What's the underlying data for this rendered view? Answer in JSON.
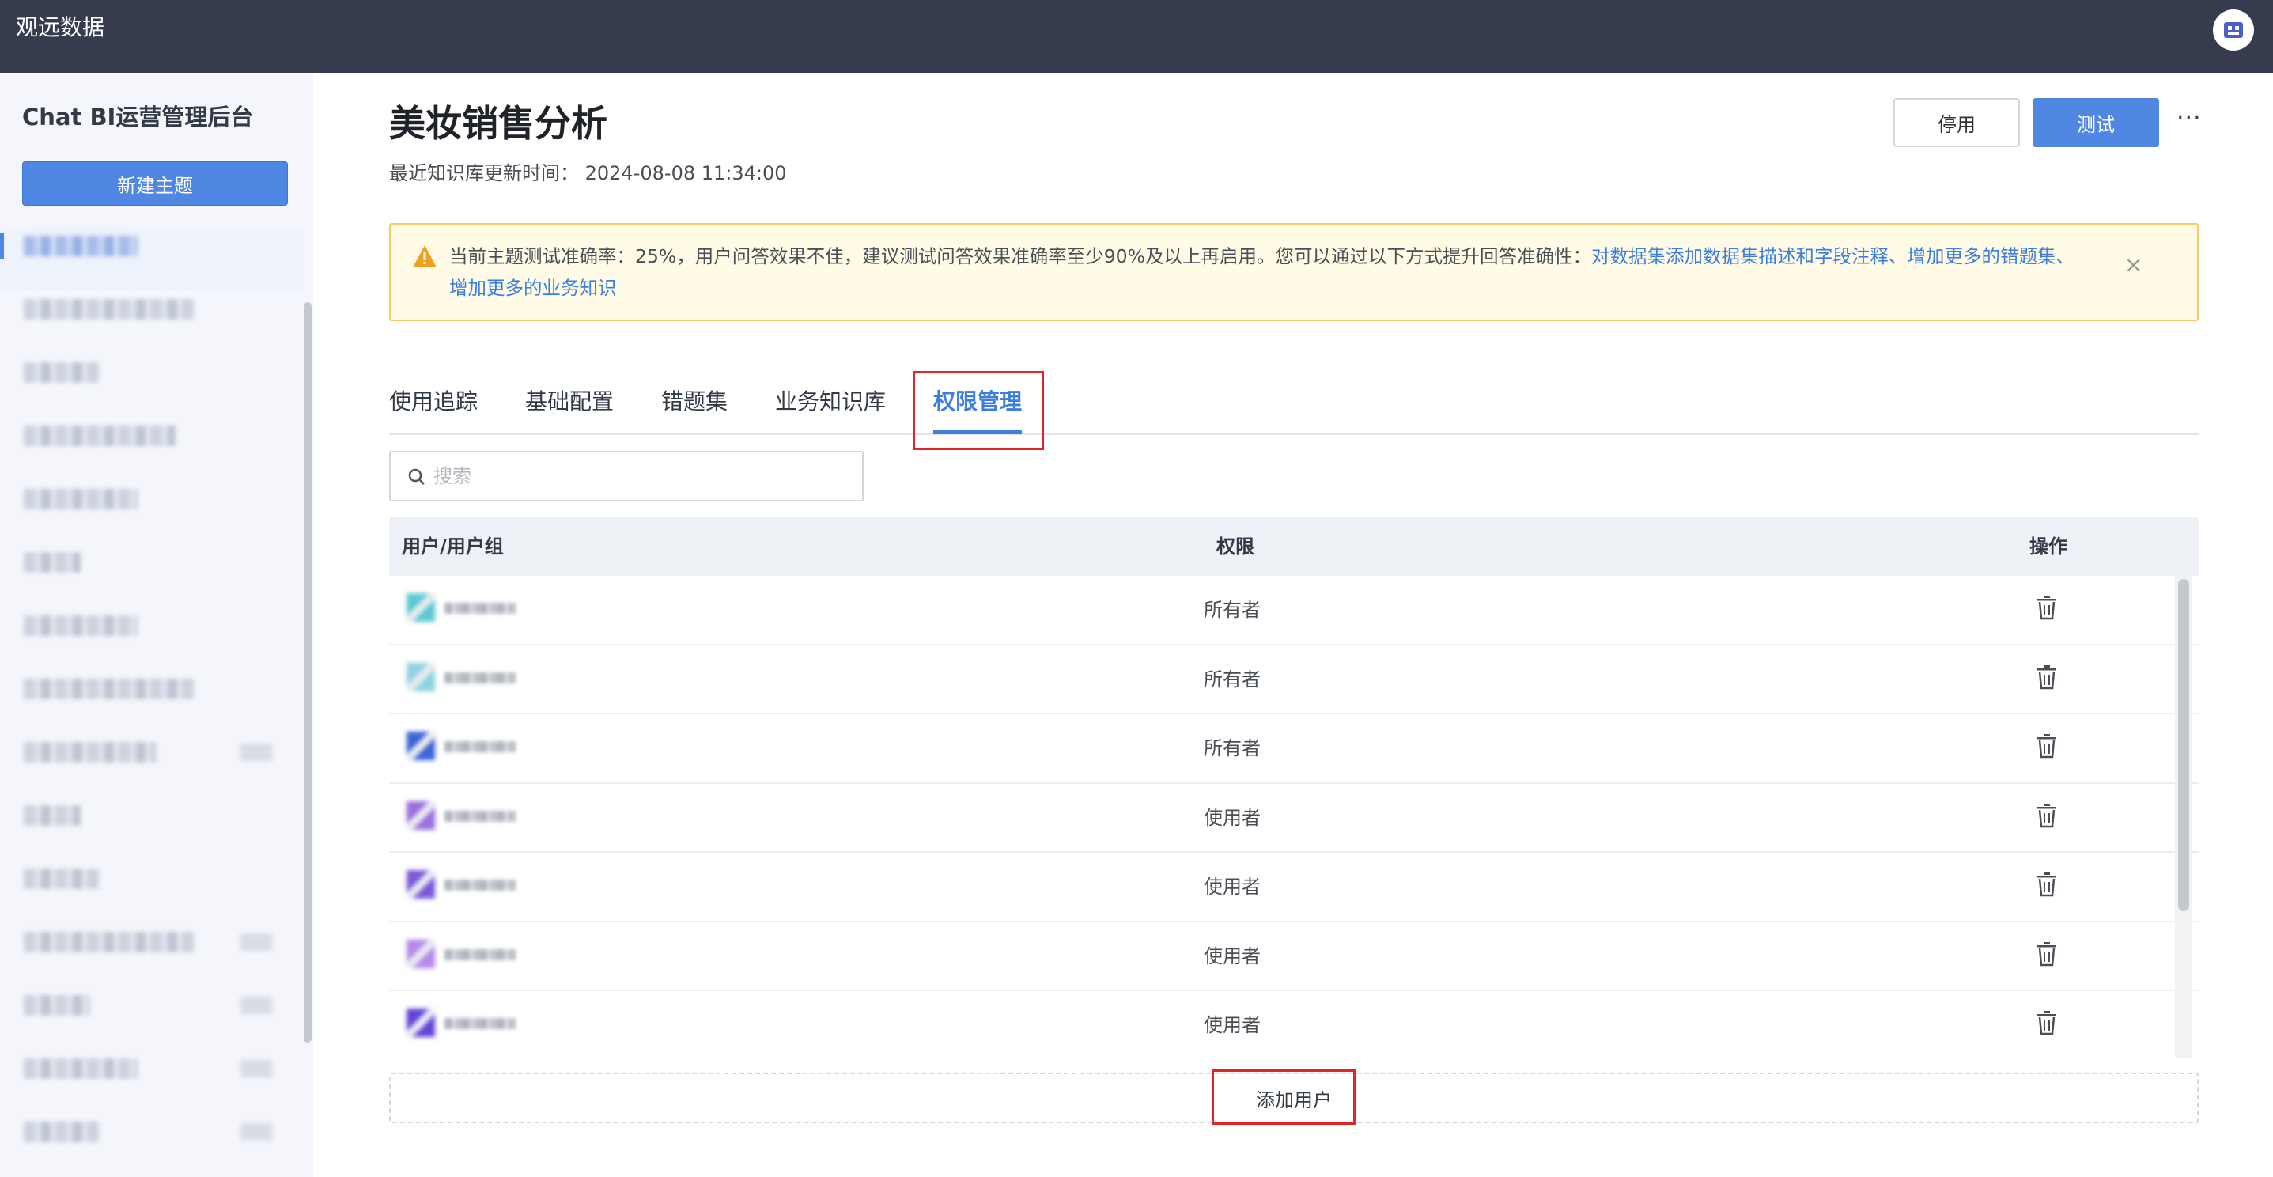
{
  "topbar": {
    "brand": "观远数据",
    "logo_icon": "brand-logo-icon"
  },
  "sidebar": {
    "title": "Chat BI运营管理后台",
    "new_topic_label": "新建主题",
    "items": [
      {
        "blur_width": 144,
        "tag": false,
        "active": true
      },
      {
        "blur_width": 216,
        "tag": false
      },
      {
        "blur_width": 96,
        "tag": false
      },
      {
        "blur_width": 192,
        "tag": false
      },
      {
        "blur_width": 144,
        "tag": false
      },
      {
        "blur_width": 72,
        "tag": false
      },
      {
        "blur_width": 144,
        "tag": false
      },
      {
        "blur_width": 216,
        "tag": false
      },
      {
        "blur_width": 168,
        "tag": true
      },
      {
        "blur_width": 72,
        "tag": false
      },
      {
        "blur_width": 96,
        "tag": false
      },
      {
        "blur_width": 216,
        "tag": true
      },
      {
        "blur_width": 84,
        "tag": true
      },
      {
        "blur_width": 144,
        "tag": true
      },
      {
        "blur_width": 96,
        "tag": true
      }
    ]
  },
  "header": {
    "title": "美妆销售分析",
    "update_time": "最近知识库更新时间： 2024-08-08 11:34:00",
    "stop_label": "停用",
    "test_label": "测试",
    "more_label": "···"
  },
  "alert": {
    "text": "当前主题测试准确率：25%，用户问答效果不佳，建议测试问答效果准确率至少90%及以上再启用。您可以通过以下方式提升回答准确性：",
    "link1": "对数据集添加数据集描述和字段注释、增加更多的错题集、",
    "link2": "增加更多的业务知识",
    "close_label": "×"
  },
  "tabs": [
    {
      "label": "使用追踪",
      "active": false
    },
    {
      "label": "基础配置",
      "active": false
    },
    {
      "label": "错题集",
      "active": false
    },
    {
      "label": "业务知识库",
      "active": false
    },
    {
      "label": "权限管理",
      "active": true
    }
  ],
  "search": {
    "placeholder": "搜索",
    "value": ""
  },
  "table": {
    "headers": [
      "用户/用户组",
      "权限",
      "操作"
    ],
    "rows": [
      {
        "permission": "所有者",
        "avatar_color": "#5cc8d4"
      },
      {
        "permission": "所有者",
        "avatar_color": "#8fd3df"
      },
      {
        "permission": "所有者",
        "avatar_color": "#3f63d6"
      },
      {
        "permission": "使用者",
        "avatar_color": "#9a6fe0"
      },
      {
        "permission": "使用者",
        "avatar_color": "#7a5ad8"
      },
      {
        "permission": "使用者",
        "avatar_color": "#b48ae8"
      },
      {
        "permission": "使用者",
        "avatar_color": "#6444d8"
      }
    ]
  },
  "add_user_label": "添加用户",
  "colors": {
    "accent": "#4f87e3",
    "topbar": "#363c4d",
    "highlight": "#e0242a",
    "alert_bg": "#fffbe6"
  }
}
